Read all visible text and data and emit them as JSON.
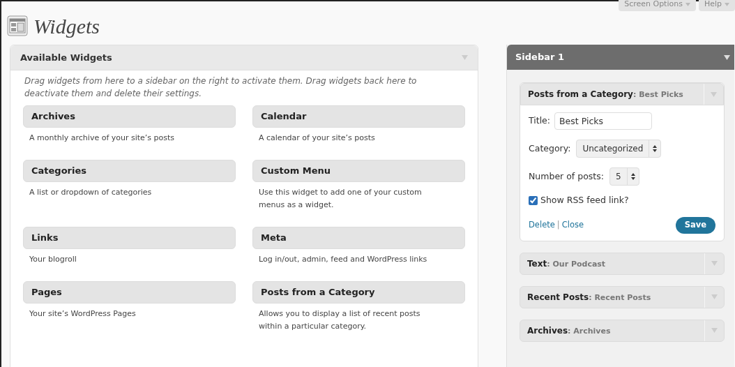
{
  "header": {
    "title": "Widgets",
    "buttons": [
      "Screen Options",
      "Help"
    ]
  },
  "available": {
    "title": "Available Widgets",
    "description": "Drag widgets from here to a sidebar on the right to activate them. Drag widgets back here to deactivate them and delete their settings.",
    "widgets": [
      {
        "name": "Archives",
        "description": "A monthly archive of your site’s posts"
      },
      {
        "name": "Calendar",
        "description": "A calendar of your site’s posts"
      },
      {
        "name": "Categories",
        "description": "A list or dropdown of categories"
      },
      {
        "name": "Custom Menu",
        "description": "Use this widget to add one of your custom menus as a widget."
      },
      {
        "name": "Links",
        "description": "Your blogroll"
      },
      {
        "name": "Meta",
        "description": "Log in/out, admin, feed and WordPress links"
      },
      {
        "name": "Pages",
        "description": "Your site’s WordPress Pages"
      },
      {
        "name": "Posts from a Category",
        "description": "Allows you to display a list of recent posts within a particular category."
      }
    ]
  },
  "sidebar": {
    "title": "Sidebar 1",
    "widgets": [
      {
        "name": "Posts from a Category",
        "instance": ": Best Picks",
        "expanded": true,
        "form": {
          "title_label": "Title:",
          "title_value": "Best Picks",
          "category_label": "Category:",
          "category_value": "Uncategorized",
          "number_label": "Number of posts:",
          "number_value": "5",
          "rss_label": "Show RSS feed link?",
          "rss_checked": true,
          "delete": "Delete",
          "separator": "|",
          "close": "Close",
          "save": "Save"
        }
      },
      {
        "name": "Text",
        "instance": ": Our Podcast",
        "expanded": false
      },
      {
        "name": "Recent Posts",
        "instance": ": Recent Posts",
        "expanded": false
      },
      {
        "name": "Archives",
        "instance": ": Archives",
        "expanded": false
      }
    ]
  }
}
